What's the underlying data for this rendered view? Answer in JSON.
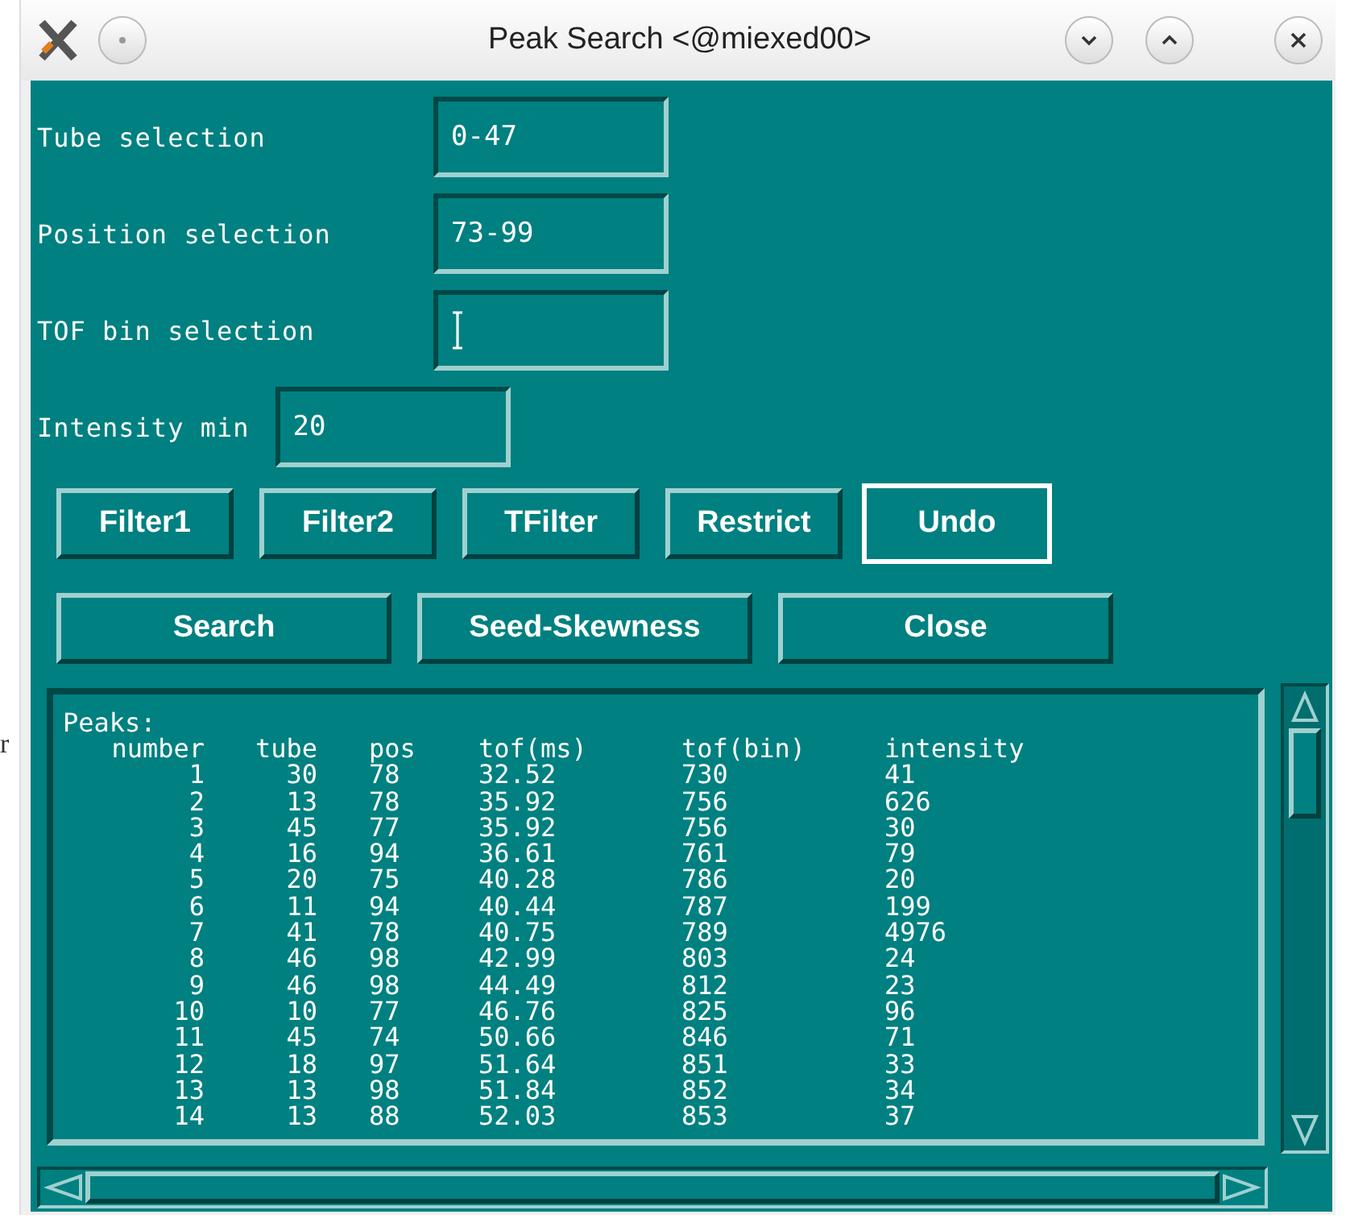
{
  "edge_text": "r",
  "window": {
    "title": "Peak Search <@miexed00>"
  },
  "selections": [
    {
      "label": "Tube selection",
      "value": "0-47",
      "pointer": false
    },
    {
      "label": "Position selection",
      "value": "73-99",
      "pointer": false
    },
    {
      "label": "TOF bin selection",
      "pointer": true
    }
  ],
  "intensity_min": {
    "label": "Intensity min",
    "value": "20"
  },
  "filter_buttons": [
    {
      "label": "Filter1",
      "focused": false
    },
    {
      "label": "Filter2",
      "focused": false
    },
    {
      "label": "TFilter",
      "focused": false
    },
    {
      "label": "Restrict",
      "focused": false
    },
    {
      "label": "Undo",
      "focused": true
    }
  ],
  "action_buttons": [
    {
      "label": "Search"
    },
    {
      "label": "Seed-Skewness"
    },
    {
      "label": "Close"
    }
  ],
  "peaks": {
    "heading": "Peaks:",
    "columns": [
      "number",
      "tube",
      "pos",
      "tof(ms)",
      "tof(bin)",
      "intensity"
    ],
    "rows": [
      [
        "1",
        "30",
        "78",
        "32.52",
        "730",
        "41"
      ],
      [
        "2",
        "13",
        "78",
        "35.92",
        "756",
        "626"
      ],
      [
        "3",
        "45",
        "77",
        "35.92",
        "756",
        "30"
      ],
      [
        "4",
        "16",
        "94",
        "36.61",
        "761",
        "79"
      ],
      [
        "5",
        "20",
        "75",
        "40.28",
        "786",
        "20"
      ],
      [
        "6",
        "11",
        "94",
        "40.44",
        "787",
        "199"
      ],
      [
        "7",
        "41",
        "78",
        "40.75",
        "789",
        "4976"
      ],
      [
        "8",
        "46",
        "98",
        "42.99",
        "803",
        "24"
      ],
      [
        "9",
        "46",
        "98",
        "44.49",
        "812",
        "23"
      ],
      [
        "10",
        "10",
        "77",
        "46.76",
        "825",
        "96"
      ],
      [
        "11",
        "45",
        "74",
        "50.66",
        "846",
        "71"
      ],
      [
        "12",
        "18",
        "97",
        "51.64",
        "851",
        "33"
      ],
      [
        "13",
        "13",
        "98",
        "51.84",
        "852",
        "34"
      ],
      [
        "14",
        "13",
        "88",
        "52.03",
        "853",
        "37"
      ]
    ]
  }
}
